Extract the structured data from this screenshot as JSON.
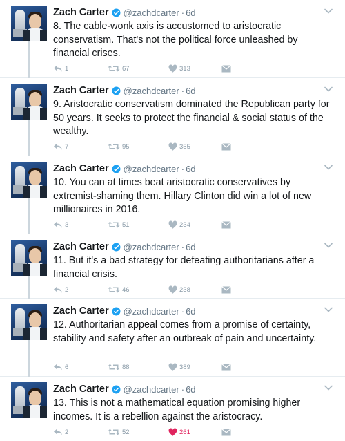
{
  "tweets": [
    {
      "name": "Zach Carter",
      "handle": "@zachdcarter",
      "time": "6d",
      "text": "8. The cable-wonk axis is accustomed to aristocratic conservatism. That's not the political force unleashed by financial crises.",
      "replies": "1",
      "retweets": "67",
      "likes": "313",
      "liked": false
    },
    {
      "name": "Zach Carter",
      "handle": "@zachdcarter",
      "time": "6d",
      "text": "9. Aristocratic conservatism dominated the Republican party for 50 years. It seeks to protect the financial & social status of the wealthy.",
      "replies": "7",
      "retweets": "95",
      "likes": "355",
      "liked": false
    },
    {
      "name": "Zach Carter",
      "handle": "@zachdcarter",
      "time": "6d",
      "text": "10. You can at times beat aristocratic conservatives by extremist-shaming them. Hillary Clinton did win a lot of new millionaires in 2016.",
      "replies": "3",
      "retweets": "51",
      "likes": "234",
      "liked": false
    },
    {
      "name": "Zach Carter",
      "handle": "@zachdcarter",
      "time": "6d",
      "text": "11. But it's a bad strategy for defeating authoritarians after a financial crisis.",
      "replies": "2",
      "retweets": "46",
      "likes": "238",
      "liked": false
    },
    {
      "name": "Zach Carter",
      "handle": "@zachdcarter",
      "time": "6d",
      "text": "12. Authoritarian appeal comes from a promise of certainty, stability and safety after an outbreak of pain and uncertainty.",
      "replies": "6",
      "retweets": "88",
      "likes": "389",
      "liked": false
    },
    {
      "name": "Zach Carter",
      "handle": "@zachdcarter",
      "time": "6d",
      "text": "13. This is not a mathematical equation promising higher incomes. It is a rebellion against the aristocracy.",
      "replies": "2",
      "retweets": "52",
      "likes": "261",
      "liked": true
    }
  ],
  "colors": {
    "text": "#14171a",
    "muted": "#657786",
    "icon": "#aab8c2",
    "verified": "#1da1f2",
    "like_active": "#e0245e",
    "thread_line": "#ccd6dd"
  },
  "icons": {
    "verified": "verified-badge-icon",
    "caret": "chevron-down-icon",
    "reply": "reply-arrow-icon",
    "retweet": "retweet-icon",
    "like": "heart-icon",
    "dm": "envelope-icon"
  }
}
